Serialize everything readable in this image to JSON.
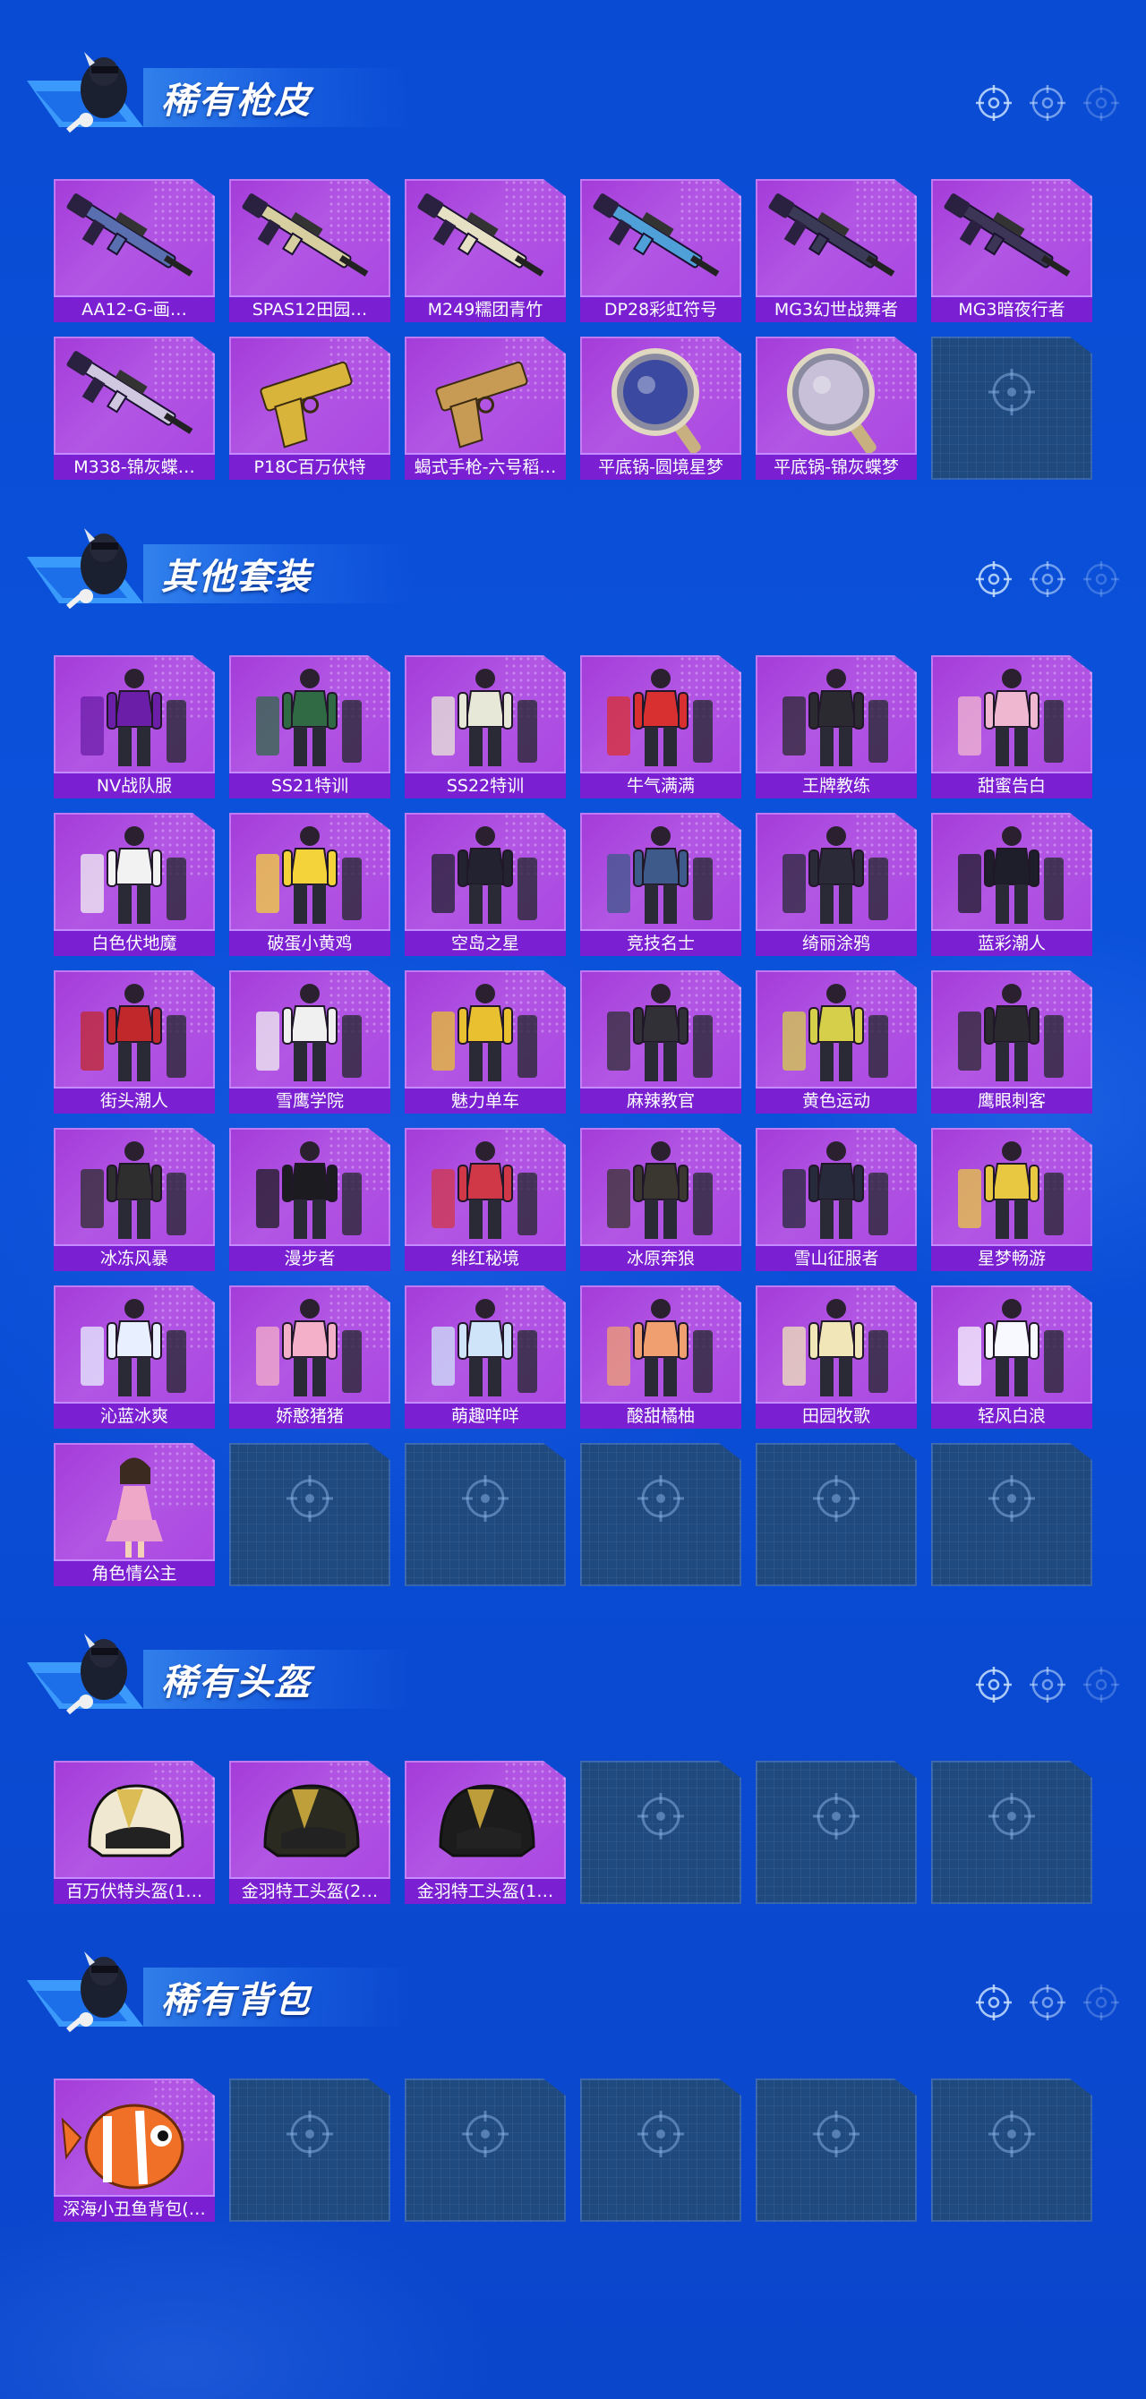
{
  "sections": [
    {
      "title": "稀有枪皮",
      "items": [
        {
          "label": "AA12-G-画…",
          "icon": "gun-icon",
          "color": "#5a6fb0"
        },
        {
          "label": "SPAS12田园…",
          "icon": "shotgun-icon",
          "color": "#d8cfa0"
        },
        {
          "label": "M249糯团青竹",
          "icon": "machinegun-icon",
          "color": "#e6e0c4"
        },
        {
          "label": "DP28彩虹符号",
          "icon": "rifle-icon",
          "color": "#4fa0d8"
        },
        {
          "label": "MG3幻世战舞者",
          "icon": "machinegun-icon",
          "color": "#3a3a56"
        },
        {
          "label": "MG3暗夜行者",
          "icon": "machinegun-icon",
          "color": "#3d3555"
        },
        {
          "label": "M338-锦灰蝶…",
          "icon": "rifle-icon",
          "color": "#d0c8e0"
        },
        {
          "label": "P18C百万伏特",
          "icon": "pistol-icon",
          "color": "#d8b43a"
        },
        {
          "label": "蝎式手枪-六号稻…",
          "icon": "pistol-icon",
          "color": "#c89b55"
        },
        {
          "label": "平底锅-圆境星梦",
          "icon": "pan-icon",
          "color": "#3b4aa0"
        },
        {
          "label": "平底锅-锦灰蝶梦",
          "icon": "pan-icon",
          "color": "#c8c0d8"
        }
      ],
      "empty_slots": 1
    },
    {
      "title": "其他套装",
      "items": [
        {
          "label": "NV战队服",
          "icon": "outfit-icon",
          "color": "#6b1fa8"
        },
        {
          "label": "SS21特训",
          "icon": "outfit-icon",
          "color": "#2f6a45"
        },
        {
          "label": "SS22特训",
          "icon": "outfit-icon",
          "color": "#e8e8d8"
        },
        {
          "label": "牛气满满",
          "icon": "outfit-icon",
          "color": "#d83030"
        },
        {
          "label": "王牌教练",
          "icon": "outfit-icon",
          "color": "#2a2a30"
        },
        {
          "label": "甜蜜告白",
          "icon": "outfit-icon",
          "color": "#f0b8d0"
        },
        {
          "label": "白色伏地魔",
          "icon": "outfit-icon",
          "color": "#f2f2f2"
        },
        {
          "label": "破蛋小黄鸡",
          "icon": "outfit-icon",
          "color": "#f4d23a"
        },
        {
          "label": "空岛之星",
          "icon": "outfit-icon",
          "color": "#222230"
        },
        {
          "label": "竞技名士",
          "icon": "outfit-icon",
          "color": "#3e5a8a"
        },
        {
          "label": "绮丽涂鸦",
          "icon": "outfit-icon",
          "color": "#2a2a38"
        },
        {
          "label": "蓝彩潮人",
          "icon": "outfit-icon",
          "color": "#1e1e2a"
        },
        {
          "label": "街头潮人",
          "icon": "outfit-icon",
          "color": "#c0282c"
        },
        {
          "label": "雪鹰学院",
          "icon": "outfit-icon",
          "color": "#f0f0f0"
        },
        {
          "label": "魅力单车",
          "icon": "outfit-icon",
          "color": "#e8c030"
        },
        {
          "label": "麻辣教官",
          "icon": "outfit-icon",
          "color": "#303036"
        },
        {
          "label": "黄色运动",
          "icon": "outfit-icon",
          "color": "#d6cf4a"
        },
        {
          "label": "鹰眼刺客",
          "icon": "outfit-icon",
          "color": "#2a2a2e"
        },
        {
          "label": "冰冻风暴",
          "icon": "outfit-icon",
          "color": "#2e2e2e"
        },
        {
          "label": "漫步者",
          "icon": "outfit-icon",
          "color": "#1c1c20"
        },
        {
          "label": "绯红秘境",
          "icon": "outfit-icon",
          "color": "#d03848"
        },
        {
          "label": "冰原奔狼",
          "icon": "outfit-icon",
          "color": "#3a3630"
        },
        {
          "label": "雪山征服者",
          "icon": "outfit-icon",
          "color": "#262a3a"
        },
        {
          "label": "星梦畅游",
          "icon": "outfit-icon",
          "color": "#e8c840"
        },
        {
          "label": "沁蓝冰爽",
          "icon": "outfit-icon",
          "color": "#e8f0ff"
        },
        {
          "label": "娇憨猪猪",
          "icon": "outfit-icon",
          "color": "#f4b0c8"
        },
        {
          "label": "萌趣咩咩",
          "icon": "outfit-icon",
          "color": "#cfe4f8"
        },
        {
          "label": "酸甜橘柚",
          "icon": "outfit-icon",
          "color": "#f0a070"
        },
        {
          "label": "田园牧歌",
          "icon": "outfit-icon",
          "color": "#f0e6b8"
        },
        {
          "label": "轻风白浪",
          "icon": "outfit-icon",
          "color": "#f8f8ff"
        },
        {
          "label": "角色情公主",
          "icon": "character-icon",
          "color": "#f0a8c8"
        }
      ],
      "empty_slots": 5
    },
    {
      "title": "稀有头盔",
      "items": [
        {
          "label": "百万伏特头盔(1…",
          "icon": "helmet-icon",
          "color": "#f0e8d0"
        },
        {
          "label": "金羽特工头盔(2…",
          "icon": "helmet-icon",
          "color": "#2a2a20"
        },
        {
          "label": "金羽特工头盔(1…",
          "icon": "helmet-icon",
          "color": "#1c1c1c"
        }
      ],
      "empty_slots": 3
    },
    {
      "title": "稀有背包",
      "items": [
        {
          "label": "深海小丑鱼背包(…",
          "icon": "backpack-icon",
          "color": "#f07028"
        }
      ],
      "empty_slots": 5
    }
  ],
  "empty_icon": "crosshair-icon",
  "colors": {
    "label_bg": "#7a1fd1",
    "card": "#ad4ce2",
    "empty": "#1f4a80"
  }
}
